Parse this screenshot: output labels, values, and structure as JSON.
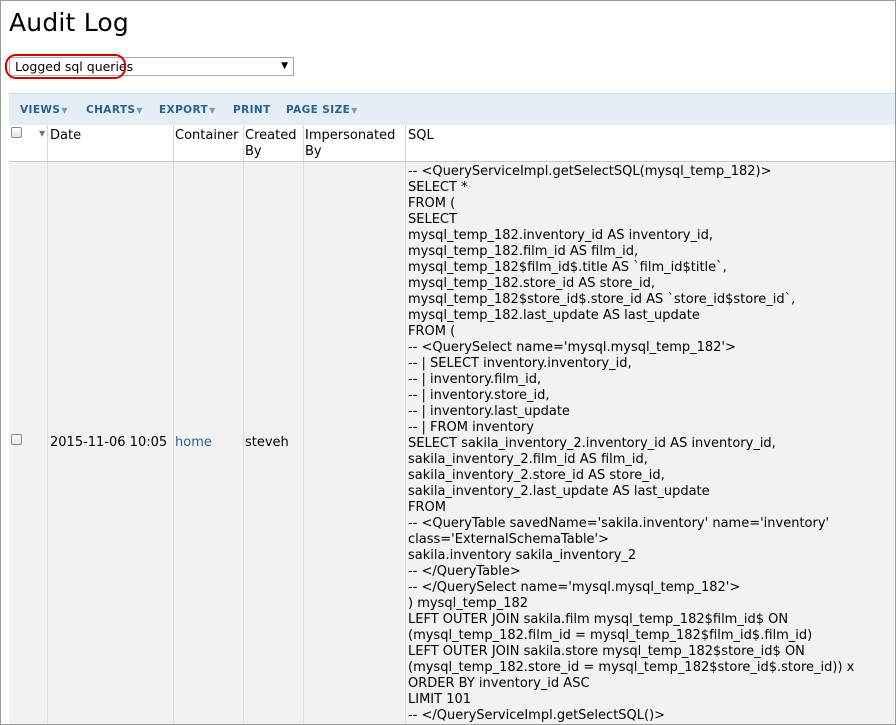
{
  "page": {
    "title": "Audit Log"
  },
  "query_selector": {
    "selected": "Logged sql queries"
  },
  "toolbar": {
    "views": "VIEWS",
    "charts": "CHARTS",
    "export": "EXPORT",
    "print": "PRINT",
    "page_size": "PAGE SIZE"
  },
  "columns": {
    "date": "Date",
    "container": "Container",
    "created_by_1": "Created",
    "created_by_2": "By",
    "impersonated_by_1": "Impersonated",
    "impersonated_by_2": "By",
    "sql": "SQL"
  },
  "rows": [
    {
      "date": "2015-11-06 10:05",
      "container": "home",
      "created_by": "steveh",
      "impersonated_by": "",
      "sql_lines": [
        "-- <QueryServiceImpl.getSelectSQL(mysql_temp_182)>",
        "SELECT *",
        "FROM (",
        "SELECT",
        "mysql_temp_182.inventory_id AS inventory_id,",
        "mysql_temp_182.film_id AS film_id,",
        "mysql_temp_182$film_id$.title AS `film_id$title`,",
        "mysql_temp_182.store_id AS store_id,",
        "mysql_temp_182$store_id$.store_id AS `store_id$store_id`,",
        "mysql_temp_182.last_update AS last_update",
        "FROM (",
        "-- <QuerySelect name='mysql.mysql_temp_182'>",
        "-- | SELECT inventory.inventory_id,",
        "-- | inventory.film_id,",
        "-- | inventory.store_id,",
        "-- | inventory.last_update",
        "-- | FROM inventory",
        "SELECT sakila_inventory_2.inventory_id AS inventory_id,",
        "sakila_inventory_2.film_id AS film_id,",
        "sakila_inventory_2.store_id AS store_id,",
        "sakila_inventory_2.last_update AS last_update",
        "FROM",
        "-- <QueryTable savedName='sakila.inventory' name='inventory'",
        "class='ExternalSchemaTable'>",
        "sakila.inventory sakila_inventory_2",
        "-- </QueryTable>",
        "-- </QuerySelect name='mysql.mysql_temp_182'>",
        ") mysql_temp_182",
        "LEFT OUTER JOIN sakila.film mysql_temp_182$film_id$ ON",
        "(mysql_temp_182.film_id = mysql_temp_182$film_id$.film_id)",
        "LEFT OUTER JOIN sakila.store mysql_temp_182$store_id$ ON",
        "(mysql_temp_182.store_id = mysql_temp_182$store_id$.store_id)) x",
        "ORDER BY inventory_id ASC",
        "LIMIT 101",
        "-- </QueryServiceImpl.getSelectSQL()>"
      ]
    }
  ]
}
